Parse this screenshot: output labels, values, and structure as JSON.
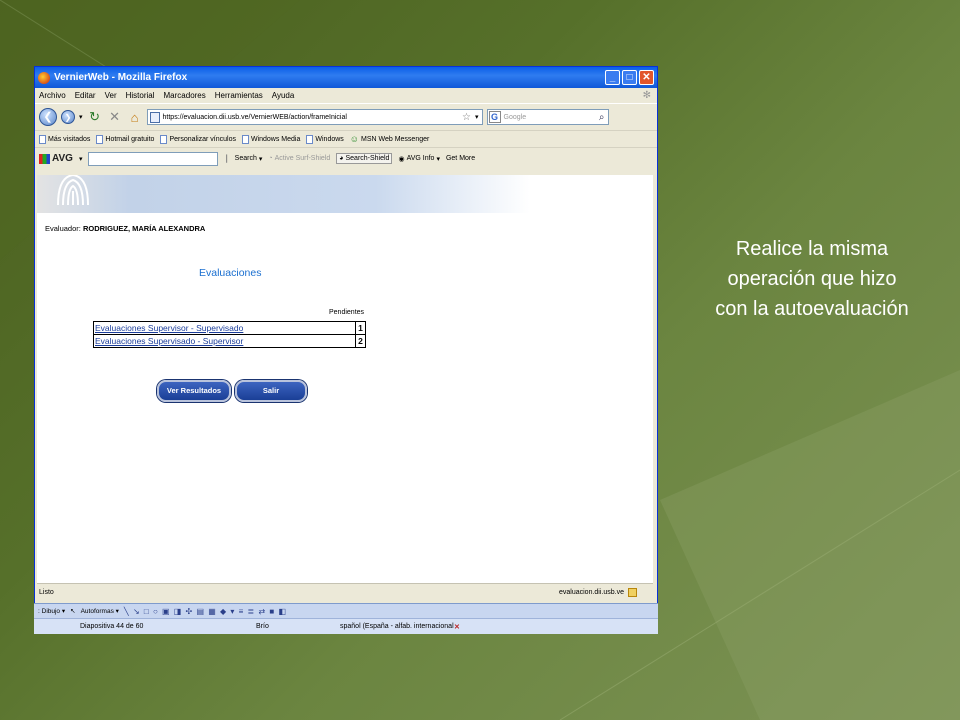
{
  "caption": {
    "line1": "Realice la misma",
    "line2": "operación que hizo",
    "line3": "con la autoevaluación"
  },
  "browser": {
    "title": "VernierWeb - Mozilla Firefox",
    "menu": [
      "Archivo",
      "Editar",
      "Ver",
      "Historial",
      "Marcadores",
      "Herramientas",
      "Ayuda"
    ],
    "url": "https://evaluacion.dii.usb.ve/VernierWEB/action/frameInicial",
    "search_placeholder": "Google",
    "bookmarks": [
      "Más visitados",
      "Hotmail gratuito",
      "Personalizar vínculos",
      "Windows Media",
      "Windows",
      "MSN Web Messenger"
    ],
    "avg": {
      "logo": "AVG",
      "search": "Search",
      "active_surf": "Active Surf-Shield",
      "search_shield": "Search-Shield",
      "avg_info": "AVG Info",
      "get_more": "Get More"
    },
    "status_left": "Listo",
    "status_right": "evaluacion.dii.usb.ve"
  },
  "page": {
    "evaluador_label": "Evaluador:",
    "evaluador_name": "RODRIGUEZ, MARÍA ALEXANDRA",
    "title": "Evaluaciones",
    "pending_header": "Pendientes",
    "rows": [
      {
        "label": "Evaluaciones Supervisor - Supervisado",
        "count": "1"
      },
      {
        "label": "Evaluaciones Supervisado - Supervisor",
        "count": "2"
      }
    ],
    "btn_results": "Ver Resultados",
    "btn_exit": "Salir"
  },
  "ppt": {
    "draw_label": "Dibujo",
    "autoshapes": "Autoformas",
    "slide_info": "Diapositiva 44 de 60",
    "theme": "Brío",
    "language": "spañol (España - alfab. internacional"
  }
}
